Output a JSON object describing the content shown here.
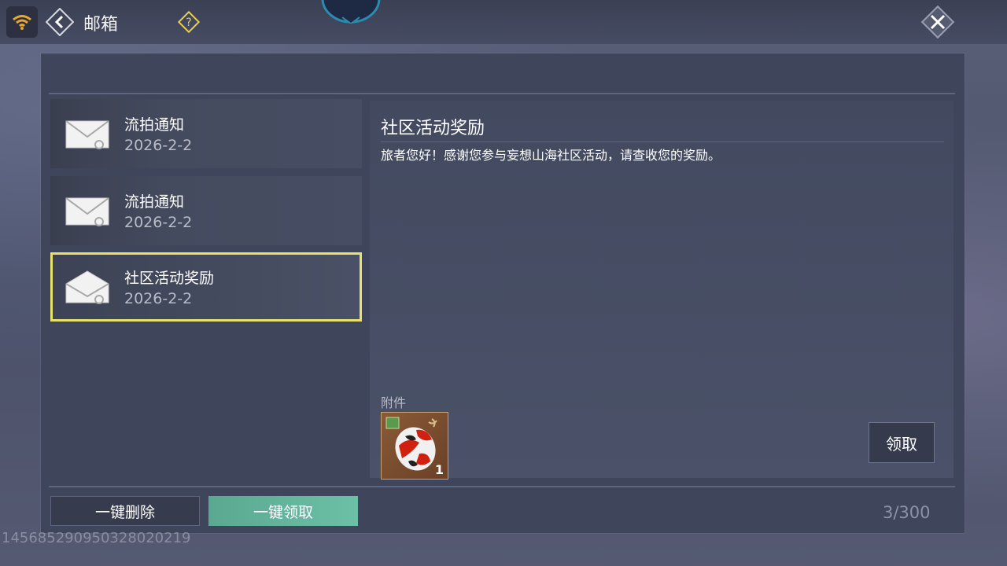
{
  "header": {
    "title": "邮箱",
    "help_icon": "question-icon",
    "back_icon": "back-arrow-icon",
    "close_icon": "close-icon",
    "wifi_icon": "wifi-icon"
  },
  "mail_list": [
    {
      "title": "流拍通知",
      "date": "2026-2-2",
      "icon": "envelope-icon",
      "selected": false
    },
    {
      "title": "流拍通知",
      "date": "2026-2-2",
      "icon": "envelope-icon",
      "selected": false
    },
    {
      "title": "社区活动奖励",
      "date": "2026-2-2",
      "icon": "envelope-open-icon",
      "selected": true
    }
  ],
  "detail": {
    "title": "社区活动奖励",
    "body": "旅者您好！感谢您参与妄想山海社区活动，请查收您的奖励。",
    "attachment_label": "附件",
    "attachments": [
      {
        "icon": "lantern-item-icon",
        "count": "1"
      }
    ],
    "claim_label": "领取"
  },
  "footer": {
    "delete_all_label": "一键删除",
    "claim_all_label": "一键领取",
    "count": "3/300"
  },
  "watermark": "1456852909503280​20219",
  "colors": {
    "selected_border": "#e8e26a",
    "claim_all_bg": "#6cc0a6",
    "panel_bg": "#3f465c"
  }
}
